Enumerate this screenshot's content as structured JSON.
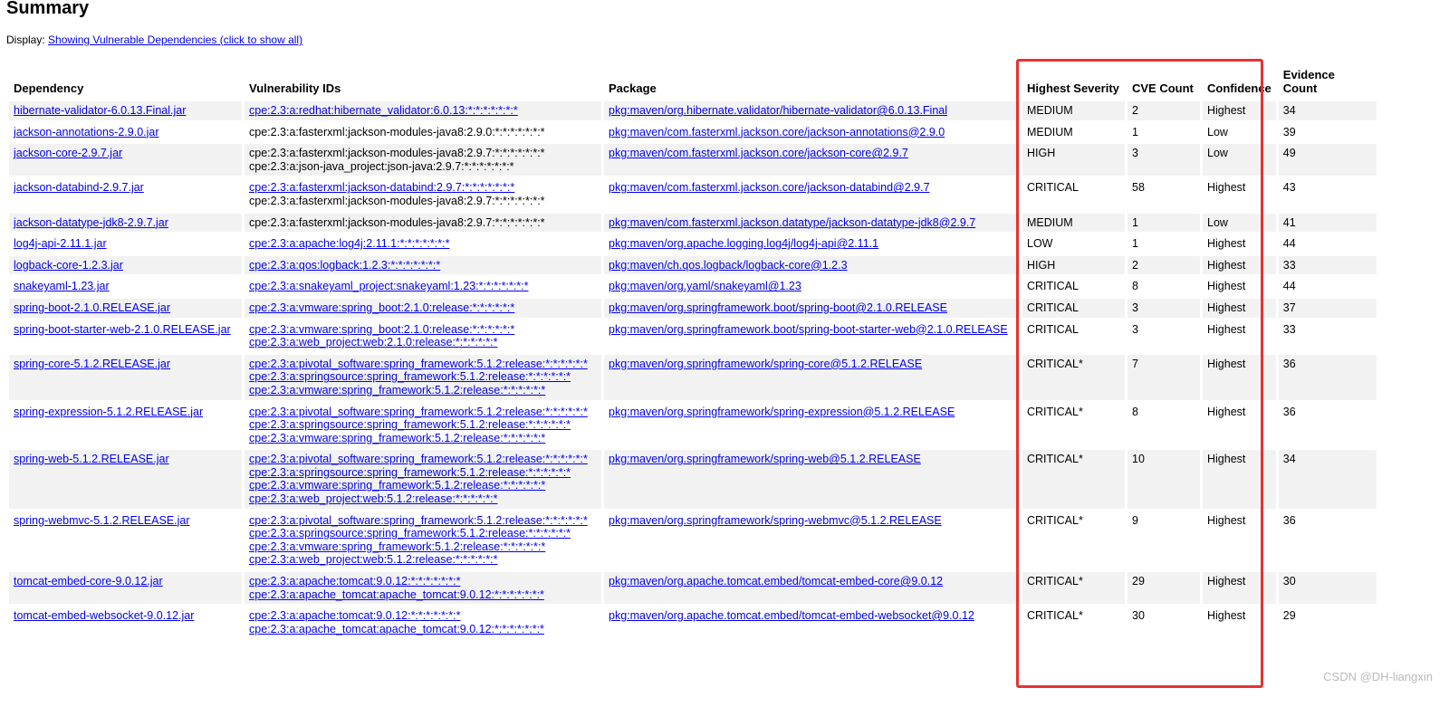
{
  "title": "Summary",
  "display": {
    "label": "Display:",
    "link": "Showing Vulnerable Dependencies (click to show all)"
  },
  "columns": [
    "Dependency",
    "Vulnerability IDs",
    "Package",
    "Highest Severity",
    "CVE Count",
    "Confidence",
    "Evidence Count"
  ],
  "rows": [
    {
      "dependency": "hibernate-validator-6.0.13.Final.jar",
      "ids": [
        {
          "t": "cpe:2.3:a:redhat:hibernate_validator:6.0.13:*:*:*:*:*:*:*",
          "link": true
        }
      ],
      "package": "pkg:maven/org.hibernate.validator/hibernate-validator@6.0.13.Final",
      "severity": "MEDIUM",
      "cve": "2",
      "confidence": "Highest",
      "evidence": "34"
    },
    {
      "dependency": "jackson-annotations-2.9.0.jar",
      "ids": [
        {
          "t": "cpe:2.3:a:fasterxml:jackson-modules-java8:2.9.0:*:*:*:*:*:*:*",
          "link": false
        }
      ],
      "package": "pkg:maven/com.fasterxml.jackson.core/jackson-annotations@2.9.0",
      "severity": "MEDIUM",
      "cve": "1",
      "confidence": "Low",
      "evidence": "39"
    },
    {
      "dependency": "jackson-core-2.9.7.jar",
      "ids": [
        {
          "t": "cpe:2.3:a:fasterxml:jackson-modules-java8:2.9.7:*:*:*:*:*:*:*",
          "link": false
        },
        {
          "t": "cpe:2.3:a:json-java_project:json-java:2.9.7:*:*:*:*:*:*:*",
          "link": false
        }
      ],
      "package": "pkg:maven/com.fasterxml.jackson.core/jackson-core@2.9.7",
      "severity": "HIGH",
      "cve": "3",
      "confidence": "Low",
      "evidence": "49"
    },
    {
      "dependency": "jackson-databind-2.9.7.jar",
      "ids": [
        {
          "t": "cpe:2.3:a:fasterxml:jackson-databind:2.9.7:*:*:*:*:*:*:*",
          "link": true
        },
        {
          "t": "cpe:2.3:a:fasterxml:jackson-modules-java8:2.9.7:*:*:*:*:*:*:*",
          "link": false
        }
      ],
      "package": "pkg:maven/com.fasterxml.jackson.core/jackson-databind@2.9.7",
      "severity": "CRITICAL",
      "cve": "58",
      "confidence": "Highest",
      "evidence": "43"
    },
    {
      "dependency": "jackson-datatype-jdk8-2.9.7.jar",
      "ids": [
        {
          "t": "cpe:2.3:a:fasterxml:jackson-modules-java8:2.9.7:*:*:*:*:*:*:*",
          "link": false
        }
      ],
      "package": "pkg:maven/com.fasterxml.jackson.datatype/jackson-datatype-jdk8@2.9.7",
      "severity": "MEDIUM",
      "cve": "1",
      "confidence": "Low",
      "evidence": "41"
    },
    {
      "dependency": "log4j-api-2.11.1.jar",
      "ids": [
        {
          "t": "cpe:2.3:a:apache:log4j:2.11.1:*:*:*:*:*:*:*",
          "link": true
        }
      ],
      "package": "pkg:maven/org.apache.logging.log4j/log4j-api@2.11.1",
      "severity": "LOW",
      "cve": "1",
      "confidence": "Highest",
      "evidence": "44"
    },
    {
      "dependency": "logback-core-1.2.3.jar",
      "ids": [
        {
          "t": "cpe:2.3:a:qos:logback:1.2.3:*:*:*:*:*:*:*",
          "link": true
        }
      ],
      "package": "pkg:maven/ch.qos.logback/logback-core@1.2.3",
      "severity": "HIGH",
      "cve": "2",
      "confidence": "Highest",
      "evidence": "33"
    },
    {
      "dependency": "snakeyaml-1.23.jar",
      "ids": [
        {
          "t": "cpe:2.3:a:snakeyaml_project:snakeyaml:1.23:*:*:*:*:*:*:*",
          "link": true
        }
      ],
      "package": "pkg:maven/org.yaml/snakeyaml@1.23",
      "severity": "CRITICAL",
      "cve": "8",
      "confidence": "Highest",
      "evidence": "44"
    },
    {
      "dependency": "spring-boot-2.1.0.RELEASE.jar",
      "ids": [
        {
          "t": "cpe:2.3:a:vmware:spring_boot:2.1.0:release:*:*:*:*:*:*",
          "link": true
        }
      ],
      "package": "pkg:maven/org.springframework.boot/spring-boot@2.1.0.RELEASE",
      "severity": "CRITICAL",
      "cve": "3",
      "confidence": "Highest",
      "evidence": "37"
    },
    {
      "dependency": "spring-boot-starter-web-2.1.0.RELEASE.jar",
      "ids": [
        {
          "t": "cpe:2.3:a:vmware:spring_boot:2.1.0:release:*:*:*:*:*:*",
          "link": true
        },
        {
          "t": "cpe:2.3:a:web_project:web:2.1.0:release:*:*:*:*:*:*",
          "link": true
        }
      ],
      "package": "pkg:maven/org.springframework.boot/spring-boot-starter-web@2.1.0.RELEASE",
      "severity": "CRITICAL",
      "cve": "3",
      "confidence": "Highest",
      "evidence": "33"
    },
    {
      "dependency": "spring-core-5.1.2.RELEASE.jar",
      "ids": [
        {
          "t": "cpe:2.3:a:pivotal_software:spring_framework:5.1.2:release:*:*:*:*:*:*",
          "link": true
        },
        {
          "t": "cpe:2.3:a:springsource:spring_framework:5.1.2:release:*:*:*:*:*:*",
          "link": true
        },
        {
          "t": "cpe:2.3:a:vmware:spring_framework:5.1.2:release:*:*:*:*:*:*",
          "link": true
        }
      ],
      "package": "pkg:maven/org.springframework/spring-core@5.1.2.RELEASE",
      "severity": "CRITICAL*",
      "cve": "7",
      "confidence": "Highest",
      "evidence": "36"
    },
    {
      "dependency": "spring-expression-5.1.2.RELEASE.jar",
      "ids": [
        {
          "t": "cpe:2.3:a:pivotal_software:spring_framework:5.1.2:release:*:*:*:*:*:*",
          "link": true
        },
        {
          "t": "cpe:2.3:a:springsource:spring_framework:5.1.2:release:*:*:*:*:*:*",
          "link": true
        },
        {
          "t": "cpe:2.3:a:vmware:spring_framework:5.1.2:release:*:*:*:*:*:*",
          "link": true
        }
      ],
      "package": "pkg:maven/org.springframework/spring-expression@5.1.2.RELEASE",
      "severity": "CRITICAL*",
      "cve": "8",
      "confidence": "Highest",
      "evidence": "36"
    },
    {
      "dependency": "spring-web-5.1.2.RELEASE.jar",
      "ids": [
        {
          "t": "cpe:2.3:a:pivotal_software:spring_framework:5.1.2:release:*:*:*:*:*:*",
          "link": true
        },
        {
          "t": "cpe:2.3:a:springsource:spring_framework:5.1.2:release:*:*:*:*:*:*",
          "link": true
        },
        {
          "t": "cpe:2.3:a:vmware:spring_framework:5.1.2:release:*:*:*:*:*:*",
          "link": true
        },
        {
          "t": "cpe:2.3:a:web_project:web:5.1.2:release:*:*:*:*:*:*",
          "link": true
        }
      ],
      "package": "pkg:maven/org.springframework/spring-web@5.1.2.RELEASE",
      "severity": "CRITICAL*",
      "cve": "10",
      "confidence": "Highest",
      "evidence": "34"
    },
    {
      "dependency": "spring-webmvc-5.1.2.RELEASE.jar",
      "ids": [
        {
          "t": "cpe:2.3:a:pivotal_software:spring_framework:5.1.2:release:*:*:*:*:*:*",
          "link": true
        },
        {
          "t": "cpe:2.3:a:springsource:spring_framework:5.1.2:release:*:*:*:*:*:*",
          "link": true
        },
        {
          "t": "cpe:2.3:a:vmware:spring_framework:5.1.2:release:*:*:*:*:*:*",
          "link": true
        },
        {
          "t": "cpe:2.3:a:web_project:web:5.1.2:release:*:*:*:*:*:*",
          "link": true
        }
      ],
      "package": "pkg:maven/org.springframework/spring-webmvc@5.1.2.RELEASE",
      "severity": "CRITICAL*",
      "cve": "9",
      "confidence": "Highest",
      "evidence": "36"
    },
    {
      "dependency": "tomcat-embed-core-9.0.12.jar",
      "ids": [
        {
          "t": "cpe:2.3:a:apache:tomcat:9.0.12:*:*:*:*:*:*:*",
          "link": true
        },
        {
          "t": "cpe:2.3:a:apache_tomcat:apache_tomcat:9.0.12:*:*:*:*:*:*:*",
          "link": true
        }
      ],
      "package": "pkg:maven/org.apache.tomcat.embed/tomcat-embed-core@9.0.12",
      "severity": "CRITICAL*",
      "cve": "29",
      "confidence": "Highest",
      "evidence": "30"
    },
    {
      "dependency": "tomcat-embed-websocket-9.0.12.jar",
      "ids": [
        {
          "t": "cpe:2.3:a:apache:tomcat:9.0.12:*:*:*:*:*:*:*",
          "link": true
        },
        {
          "t": "cpe:2.3:a:apache_tomcat:apache_tomcat:9.0.12:*:*:*:*:*:*:*",
          "link": true
        }
      ],
      "package": "pkg:maven/org.apache.tomcat.embed/tomcat-embed-websocket@9.0.12",
      "severity": "CRITICAL*",
      "cve": "30",
      "confidence": "Highest",
      "evidence": "29"
    }
  ],
  "watermark": "CSDN @DH-liangxin",
  "colors": {
    "link": "#0000ee",
    "row_alt": "#f2f2f2",
    "highlight_border": "#e53333"
  }
}
